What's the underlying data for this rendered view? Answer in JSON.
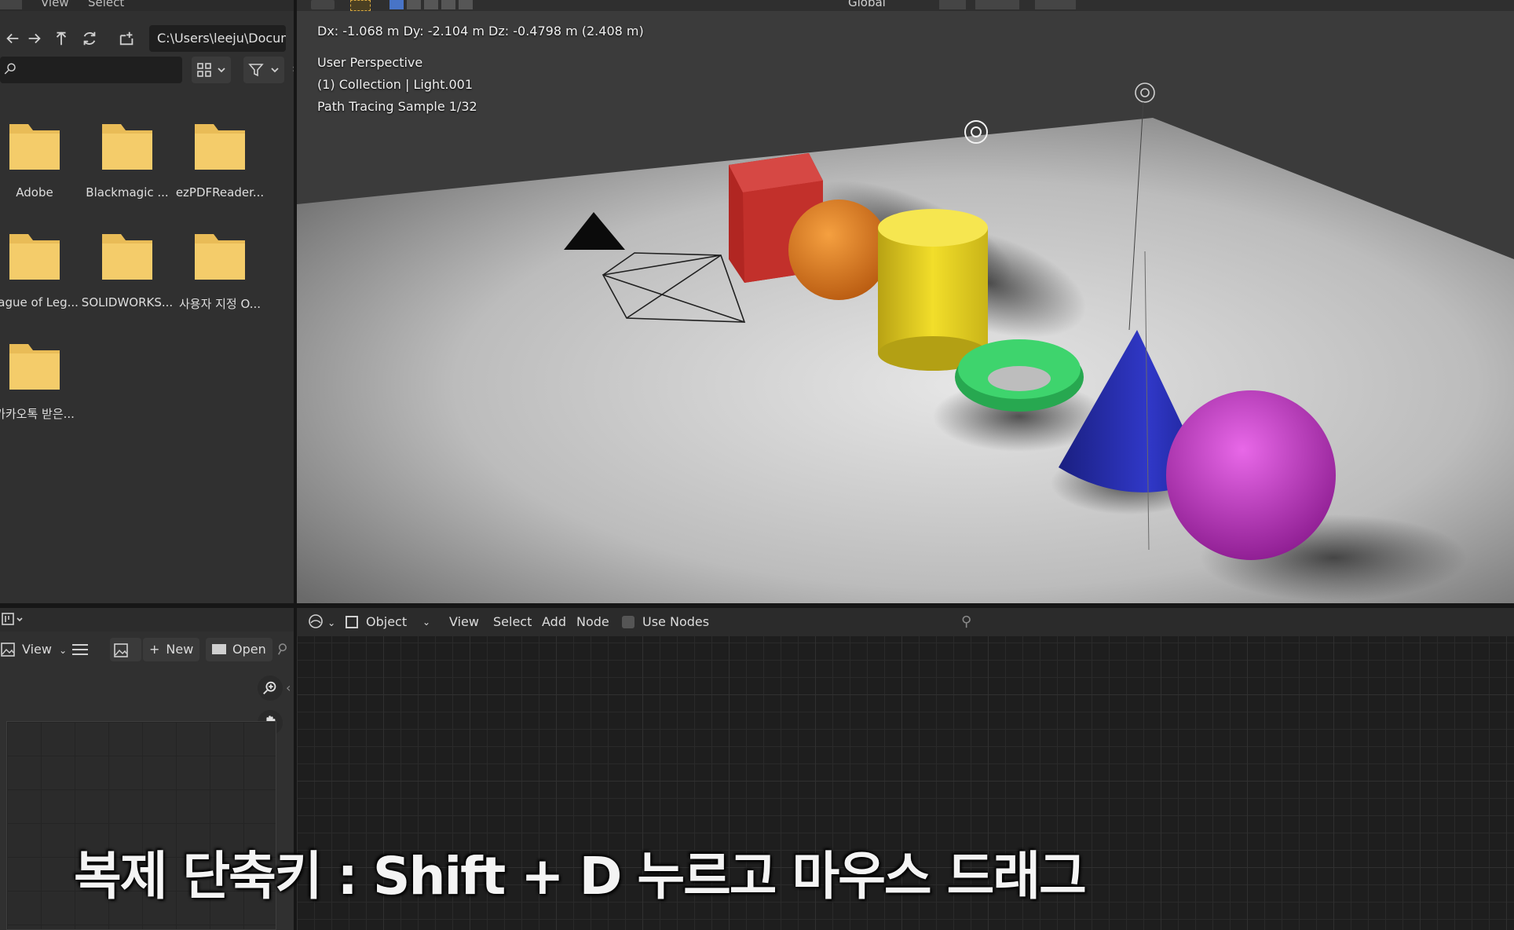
{
  "file_browser": {
    "menu": [
      "View",
      "Select"
    ],
    "path": "C:\\Users\\leeju\\Docum...",
    "folders": [
      {
        "name": "Adobe"
      },
      {
        "name": "Blackmagic ..."
      },
      {
        "name": "ezPDFReader..."
      },
      {
        "name": "eague of Leg..."
      },
      {
        "name": "SOLIDWORKS..."
      },
      {
        "name": "사용자 지정 O..."
      },
      {
        "name": "카카오톡 받은..."
      }
    ]
  },
  "viewport": {
    "header_orientation": "Global",
    "delta_readout": "Dx: -1.068 m  Dy: -2.104 m  Dz: -0.4798 m (2.408 m)",
    "perspective": "User Perspective",
    "collection": "(1) Collection | Light.001",
    "render_status": "Path Tracing Sample 1/32",
    "object_colors": {
      "cube": "#c8302c",
      "orange_sphere": "#e07a16",
      "cylinder": "#e8d31c",
      "torus": "#2fc45e",
      "cone": "#2830b8",
      "sphere": "#c236c4"
    }
  },
  "image_editor": {
    "view_label": "View",
    "new_label": "New",
    "open_label": "Open"
  },
  "node_editor": {
    "mode_label": "Object",
    "menu_view": "View",
    "menu_select": "Select",
    "menu_add": "Add",
    "menu_node": "Node",
    "use_nodes_label": "Use Nodes"
  },
  "subtitle": "복제 단축키 : Shift + D 누르고 마우스 드래그"
}
